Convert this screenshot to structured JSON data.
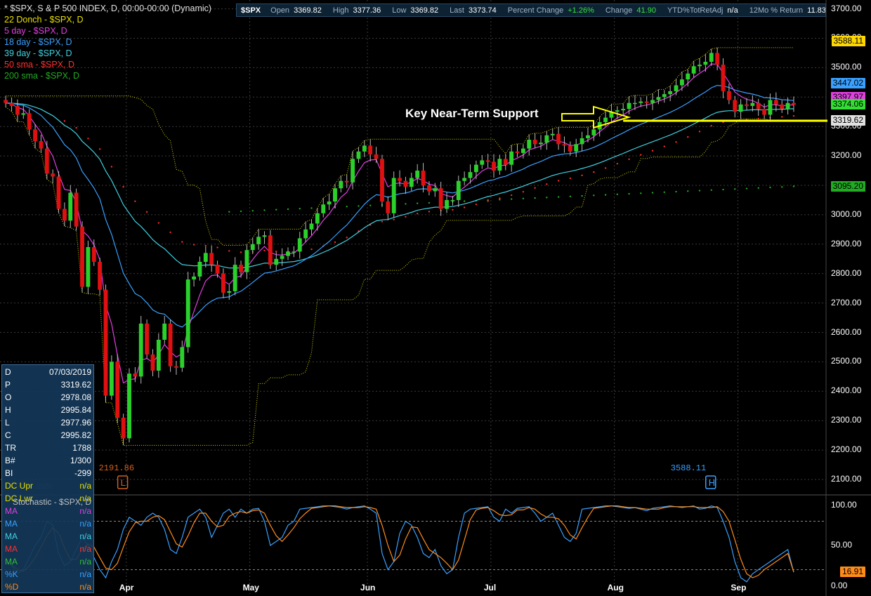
{
  "legend": {
    "title": "* $SPX, S & P 500 INDEX, D, 00:00-00:00 (Dynamic)",
    "donch": "22 Donch - $SPX, D",
    "ma5": "5 day - $SPX, D",
    "ma18": "18 day - $SPX, D",
    "ma39": "39 day - $SPX, D",
    "sma50": "50 sma - $SPX, D",
    "sma200": "200 sma - $SPX, D"
  },
  "quote": {
    "symbol": "$SPX",
    "open_label": "Open",
    "open": "3369.82",
    "high_label": "High",
    "high": "3377.36",
    "low_label": "Low",
    "low": "3369.82",
    "last_label": "Last",
    "last": "3373.74",
    "pct_label": "Percent Change",
    "pct": "+1.26%",
    "chg_label": "Change",
    "chg": "41.90",
    "ytd_label": "YTD%TotRetAdj",
    "ytd": "n/a",
    "ret_label": "12Mo % Return",
    "ret": "11.83"
  },
  "annotation": "Key Near-Term Support",
  "data_window": [
    {
      "label": "D",
      "value": "07/03/2019",
      "color": "#ffffff"
    },
    {
      "label": "P",
      "value": "3319.62",
      "color": "#ffffff"
    },
    {
      "label": "O",
      "value": "2978.08",
      "color": "#ffffff"
    },
    {
      "label": "H",
      "value": "2995.84",
      "color": "#ffffff"
    },
    {
      "label": "L",
      "value": "2977.96",
      "color": "#ffffff"
    },
    {
      "label": "C",
      "value": "2995.82",
      "color": "#ffffff"
    },
    {
      "label": "TR",
      "value": "1788",
      "color": "#ffffff"
    },
    {
      "label": "B#",
      "value": "1/300",
      "color": "#ffffff"
    },
    {
      "label": "BI",
      "value": "-299",
      "color": "#ffffff"
    },
    {
      "label": "DC Upr",
      "value": "n/a",
      "color": "#e8e000"
    },
    {
      "label": "DC Lwr",
      "value": "n/a",
      "color": "#e8e000"
    },
    {
      "label": "MA",
      "value": "n/a",
      "color": "#e040e0"
    },
    {
      "label": "MA",
      "value": "n/a",
      "color": "#3aa0ff"
    },
    {
      "label": "MA",
      "value": "n/a",
      "color": "#40d0e0"
    },
    {
      "label": "MA",
      "value": "n/a",
      "color": "#ff3030"
    },
    {
      "label": "MA",
      "value": "n/a",
      "color": "#30c030"
    },
    {
      "label": "%K",
      "value": "n/a",
      "color": "#3aa0ff"
    },
    {
      "label": "%D",
      "value": "n/a",
      "color": "#ff8c1a"
    }
  ],
  "watermark": "2020",
  "stoch_title": "Stochastic - $SPX, D",
  "low_marker": {
    "value": "2191.86",
    "letter": "L"
  },
  "high_marker": {
    "value": "3588.11",
    "letter": "H"
  },
  "price_tags": [
    {
      "value": "3588.11",
      "bg": "#ffd700",
      "y": 3588.11
    },
    {
      "value": "3447.02",
      "bg": "#3aa0ff",
      "y": 3447.02
    },
    {
      "value": "3397.97",
      "bg": "#e040e0",
      "y": 3397.97
    },
    {
      "value": "3374.06",
      "bg": "#33dd33",
      "y": 3374.06
    },
    {
      "value": "3319.62",
      "bg": "#e0e0e0",
      "y": 3319.62
    },
    {
      "value": "3095.20",
      "bg": "#22aa22",
      "y": 3095.2
    }
  ],
  "stoch_tags": [
    {
      "value": "16.91",
      "bg": "#ff8c1a",
      "y": 16.91
    }
  ],
  "colors": {
    "up": "#2bd12b",
    "down": "#e01010",
    "donch": "#d8d800",
    "ma5": "#e040e0",
    "ma18": "#3aa0ff",
    "ma39": "#40d0e0",
    "sma50": "#ff2a2a",
    "sma200": "#22aa22",
    "support": "#ffff00",
    "k": "#3aa0ff",
    "d": "#ff8c1a"
  },
  "chart_data": {
    "type": "candlestick",
    "title": "* $SPX, S & P 500 INDEX, D, 00:00-00:00 (Dynamic)",
    "price_ylim": [
      2050,
      3730
    ],
    "price_ticks": [
      2100,
      2200,
      2300,
      2400,
      2500,
      2600,
      2700,
      2800,
      2900,
      3000,
      3100,
      3200,
      3300,
      3400,
      3500,
      3600,
      3700
    ],
    "stoch_ylim": [
      -10,
      110
    ],
    "stoch_ticks": [
      0,
      50,
      100
    ],
    "stoch_tick_labels": [
      "0.00",
      "50.00",
      "100.00"
    ],
    "price_tick_labels": [
      "2100.00",
      "2200.00",
      "2300.00",
      "2400.00",
      "2500.00",
      "2600.00",
      "2700.00",
      "2800.00",
      "2900.00",
      "3000.00",
      "3100.00",
      "3200.00",
      "3300.00",
      "3400.00",
      "3500.00",
      "3600.00",
      "3700.00"
    ],
    "months": [
      {
        "label": "Apr",
        "bar": 21
      },
      {
        "label": "May",
        "bar": 42
      },
      {
        "label": "Jun",
        "bar": 62
      },
      {
        "label": "Jul",
        "bar": 83
      },
      {
        "label": "Aug",
        "bar": 104
      },
      {
        "label": "Sep",
        "bar": 125
      }
    ],
    "bars_span": 140,
    "closes": [
      3380,
      3370,
      3340,
      3345,
      3290,
      3250,
      3225,
      3140,
      3130,
      3020,
      2980,
      3075,
      2960,
      2755,
      2890,
      2840,
      2745,
      2385,
      2500,
      2310,
      2240,
      2460,
      2450,
      2630,
      2525,
      2470,
      2575,
      2630,
      2485,
      2480,
      2550,
      2780,
      2790,
      2840,
      2870,
      2830,
      2800,
      2735,
      2740,
      2830,
      2805,
      2880,
      2900,
      2925,
      2930,
      2830,
      2850,
      2860,
      2875,
      2875,
      2920,
      2950,
      2970,
      3005,
      3035,
      3045,
      3090,
      3115,
      3110,
      3190,
      3215,
      3235,
      3205,
      3190,
      3045,
      3005,
      3125,
      3115,
      3095,
      3125,
      3150,
      3100,
      3080,
      3090,
      3020,
      3050,
      3050,
      3115,
      3125,
      3145,
      3170,
      3185,
      3180,
      3150,
      3190,
      3170,
      3215,
      3210,
      3225,
      3255,
      3240,
      3245,
      3270,
      3275,
      3240,
      3235,
      3215,
      3240,
      3260,
      3270,
      3290,
      3315,
      3330,
      3350,
      3355,
      3360,
      3380,
      3380,
      3385,
      3380,
      3390,
      3400,
      3410,
      3420,
      3440,
      3460,
      3480,
      3505,
      3510,
      3520,
      3550,
      3510,
      3420,
      3390,
      3350,
      3375,
      3370,
      3380,
      3360,
      3340,
      3390,
      3375,
      3360,
      3380,
      3373.74
    ]
  },
  "stoch_k": [
    30,
    25,
    15,
    20,
    35,
    50,
    60,
    80,
    75,
    40,
    25,
    30,
    45,
    60,
    50,
    35,
    20,
    10,
    30,
    45,
    70,
    85,
    80,
    75,
    85,
    90,
    85,
    70,
    45,
    40,
    60,
    85,
    90,
    95,
    85,
    60,
    75,
    90,
    95,
    85,
    95,
    90,
    95,
    96,
    80,
    50,
    55,
    60,
    75,
    80,
    95,
    96,
    97,
    98,
    99,
    99,
    98,
    97,
    95,
    97,
    98,
    99,
    95,
    90,
    40,
    20,
    30,
    65,
    80,
    75,
    60,
    40,
    35,
    45,
    25,
    15,
    20,
    60,
    90,
    95,
    96,
    97,
    98,
    85,
    80,
    95,
    90,
    96,
    97,
    98,
    90,
    80,
    85,
    90,
    75,
    60,
    55,
    65,
    95,
    96,
    97,
    98,
    99,
    99,
    98,
    97,
    96,
    97,
    95,
    93,
    96,
    97,
    98,
    99,
    98,
    97,
    98,
    99,
    95,
    96,
    99,
    97,
    80,
    60,
    30,
    10,
    5,
    15,
    20,
    25,
    30,
    35,
    40,
    45,
    16.91
  ],
  "stoch_d": [
    28,
    26,
    20,
    18,
    25,
    35,
    48,
    62,
    72,
    65,
    47,
    32,
    33,
    45,
    52,
    48,
    35,
    22,
    20,
    28,
    48,
    67,
    78,
    80,
    80,
    85,
    87,
    82,
    67,
    52,
    48,
    62,
    78,
    90,
    90,
    80,
    73,
    75,
    86,
    90,
    92,
    90,
    93,
    94,
    90,
    75,
    62,
    55,
    63,
    72,
    83,
    90,
    96,
    97,
    98,
    99,
    99,
    98,
    97,
    97,
    97,
    98,
    97,
    95,
    75,
    50,
    30,
    38,
    58,
    73,
    72,
    58,
    45,
    40,
    35,
    28,
    20,
    32,
    57,
    82,
    94,
    96,
    97,
    93,
    88,
    87,
    88,
    94,
    94,
    97,
    95,
    89,
    85,
    85,
    83,
    75,
    63,
    58,
    72,
    85,
    96,
    97,
    98,
    99,
    99,
    98,
    97,
    97,
    96,
    95,
    95,
    95,
    97,
    98,
    98,
    98,
    98,
    98,
    97,
    97,
    97,
    98,
    92,
    80,
    57,
    33,
    15,
    10,
    13,
    20,
    25,
    30,
    35,
    40,
    16.91
  ]
}
